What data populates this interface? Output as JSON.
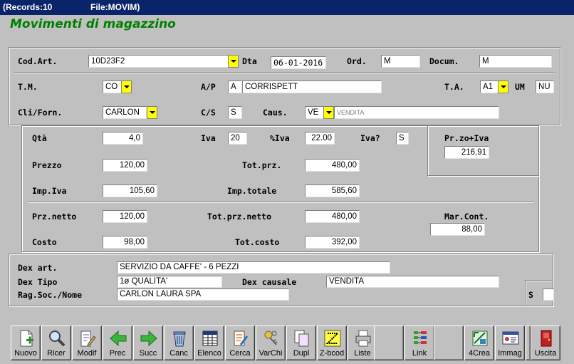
{
  "window": {
    "records": "(Records:10",
    "file": "File:MOVIM)"
  },
  "form_title": "Movimenti di magazzino",
  "header": {
    "cod_art_label": "Cod.Art.",
    "cod_art": "10D23F2",
    "dta_label": "Dta",
    "dta": "06-01-2016",
    "ord_label": "Ord.",
    "ord": "M",
    "docum_label": "Docum.",
    "docum": "M",
    "tm_label": "T.M.",
    "tm": "CO",
    "ap_label": "A/P",
    "ap": "A",
    "ap_name": "CORRISPETT",
    "ta_label": "T.A.",
    "ta": "A1",
    "um_label": "UM",
    "um": "NU",
    "cli_label": "Cli/Forn.",
    "cli": "CARLON",
    "cs_label": "C/S",
    "cs": "S",
    "caus_label": "Caus.",
    "caus": "VE",
    "caus_desc": "VENDITA"
  },
  "values": {
    "qta_label": "Qtà",
    "qta": "4,0",
    "iva_label": "Iva",
    "iva": "20",
    "piva_label": "%Iva",
    "piva": "22.00",
    "ivaq_label": "Iva?",
    "ivaq": "S",
    "przivа_label": "Pr.zo+Iva",
    "przivа": "216,91",
    "prezzo_label": "Prezzo",
    "prezzo": "120,00",
    "totprz_label": "Tot.prz.",
    "totprz": "480,00",
    "impiva_label": "Imp.Iva",
    "impiva": "105,60",
    "imptot_label": "Imp.totale",
    "imptot": "585,60",
    "prznetto_label": "Prz.netto",
    "prznetto": "120,00",
    "totprznetto_label": "Tot.prz.netto",
    "totprznetto": "480,00",
    "marcont_label": "Mar.Cont.",
    "marcont": "88,00",
    "costo_label": "Costo",
    "costo": "98,00",
    "totcosto_label": "Tot.costo",
    "totcosto": "392,00"
  },
  "descr": {
    "dexart_label": "Dex art.",
    "dexart": "SERVIZIO DA CAFFE' - 6 PEZZI",
    "dextipo_label": "Dex Tipo",
    "dextipo": "1ø QUALITA'",
    "dexcaus_label": "Dex causale",
    "dexcaus": "VENDITA",
    "ragsoc_label": "Rag.Soc./Nome",
    "ragsoc": "CARLON LAURA SPA",
    "s_label": "S",
    "s": ""
  },
  "toolbar": [
    {
      "label": "Nuovo",
      "icon": "new-doc-icon"
    },
    {
      "label": "Ricer",
      "icon": "magnifier-icon"
    },
    {
      "label": "Modif",
      "icon": "edit-doc-icon"
    },
    {
      "label": "Prec",
      "icon": "arrow-left-icon"
    },
    {
      "label": "Succ",
      "icon": "arrow-right-icon"
    },
    {
      "label": "Canc",
      "icon": "trash-icon"
    },
    {
      "label": "Elenco",
      "icon": "grid-icon"
    },
    {
      "label": "Cerca",
      "icon": "search-list-icon"
    },
    {
      "label": "VarChi",
      "icon": "keys-icon"
    },
    {
      "label": "Dupl",
      "icon": "copy-icon"
    },
    {
      "label": "Z-bcod",
      "icon": "barcode-icon"
    },
    {
      "label": "Liste",
      "icon": "printer-icon"
    },
    {
      "label": "",
      "icon": ""
    },
    {
      "label": "Link",
      "icon": "link-icon"
    },
    {
      "label": "",
      "icon": ""
    },
    {
      "label": "4Crea",
      "icon": "crea-icon"
    },
    {
      "label": "Immag",
      "icon": "image-card-icon"
    },
    {
      "label": "",
      "icon": ""
    },
    {
      "label": "Uscita",
      "icon": "exit-door-icon"
    }
  ]
}
